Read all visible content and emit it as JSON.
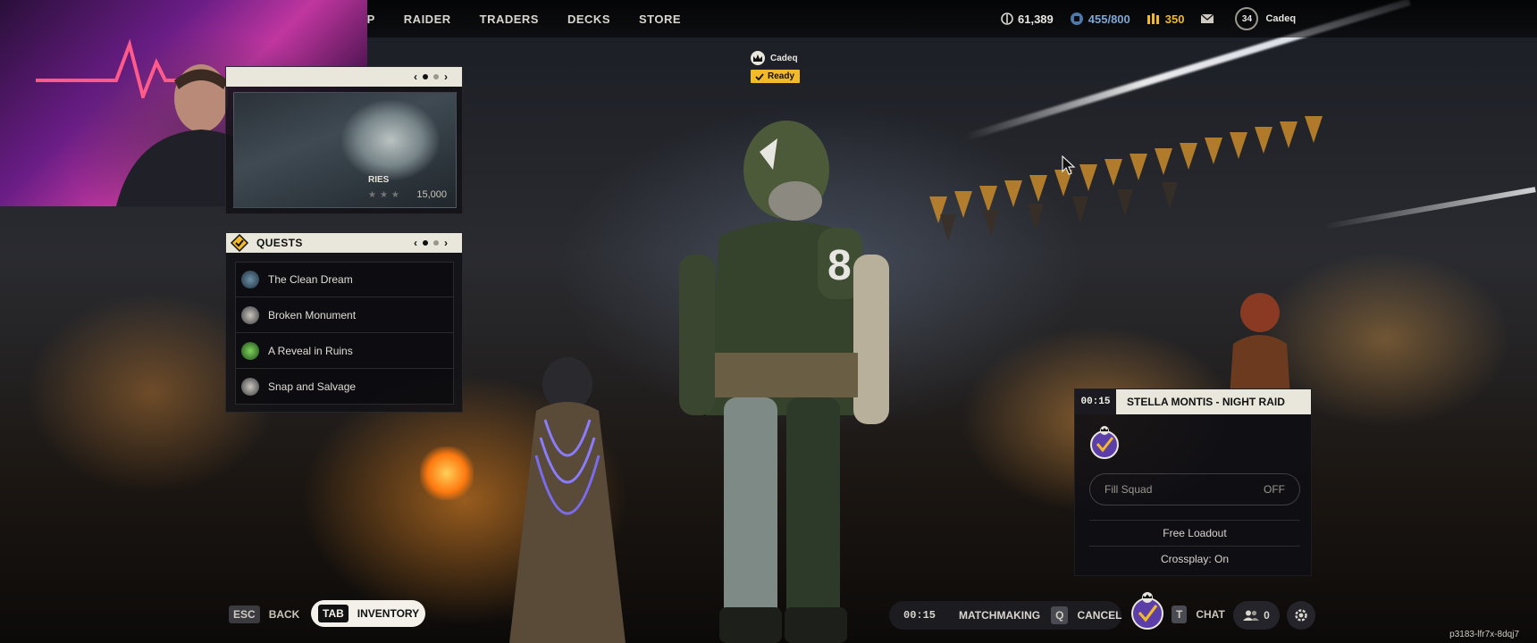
{
  "nav": {
    "items": [
      "OP",
      "RAIDER",
      "TRADERS",
      "DECKS",
      "STORE"
    ]
  },
  "currencies": {
    "coins": "61,389",
    "capacity": "455/800",
    "premium": "350"
  },
  "player": {
    "level": "34",
    "name": "Cadeq"
  },
  "party": {
    "member_name": "Cadeq",
    "status": "Ready"
  },
  "store_card": {
    "label": "RIES",
    "price": "15,000"
  },
  "quests": {
    "title": "QUESTS",
    "items": [
      {
        "name": "The Clean Dream"
      },
      {
        "name": "Broken Monument"
      },
      {
        "name": "A Reveal in Ruins"
      },
      {
        "name": "Snap and Salvage"
      }
    ]
  },
  "lobby": {
    "timer": "00:15",
    "mode": "STELLA MONTIS - NIGHT RAID",
    "fill_squad_label": "Fill Squad",
    "fill_squad_value": "OFF",
    "loadout": "Free Loadout",
    "crossplay": "Crossplay: On"
  },
  "bottom": {
    "back_key": "ESC",
    "back_label": "BACK",
    "inventory_key": "TAB",
    "inventory_label": "INVENTORY",
    "mm_timer": "00:15",
    "mm_label": "MATCHMAKING",
    "cancel_key": "Q",
    "cancel_label": "CANCEL",
    "chat_key": "T",
    "chat_label": "CHAT",
    "friends_count": "0"
  },
  "session_id": "p3183-lfr7x-8dqj7",
  "colors": {
    "accent_yellow": "#f2b929",
    "panel_light": "#e9e6dc",
    "capacity_blue": "#7ea6d4"
  }
}
